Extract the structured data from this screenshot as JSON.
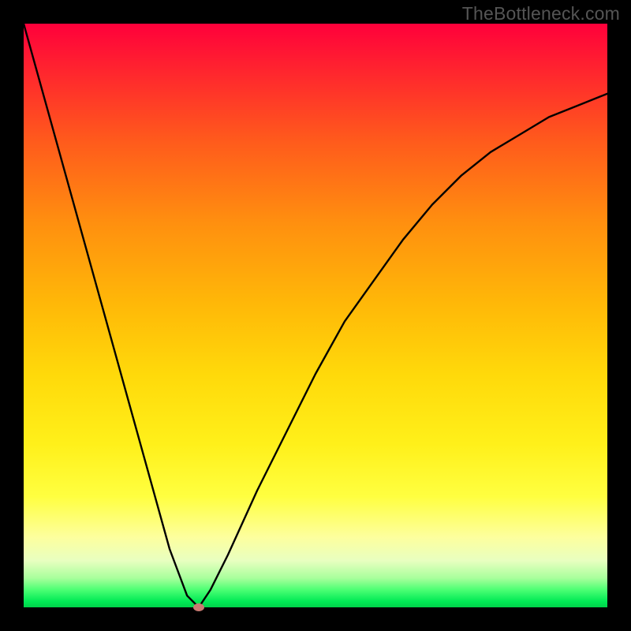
{
  "watermark": "TheBottleneck.com",
  "chart_data": {
    "type": "line",
    "title": "",
    "xlabel": "",
    "ylabel": "",
    "xlim": [
      0,
      100
    ],
    "ylim": [
      0,
      100
    ],
    "grid": false,
    "legend": false,
    "series": [
      {
        "name": "bottleneck-curve",
        "x": [
          0,
          5,
          10,
          15,
          20,
          25,
          28,
          30,
          32,
          35,
          40,
          45,
          50,
          55,
          60,
          65,
          70,
          75,
          80,
          85,
          90,
          95,
          100
        ],
        "values": [
          100,
          82,
          64,
          46,
          28,
          10,
          2,
          0,
          3,
          9,
          20,
          30,
          40,
          49,
          56,
          63,
          69,
          74,
          78,
          81,
          84,
          86,
          88
        ]
      }
    ],
    "annotations": [
      {
        "name": "optimum-root",
        "x": 30,
        "y": 0
      }
    ],
    "background_gradient": {
      "top": "#ff003b",
      "bottom": "#00d24a"
    }
  }
}
